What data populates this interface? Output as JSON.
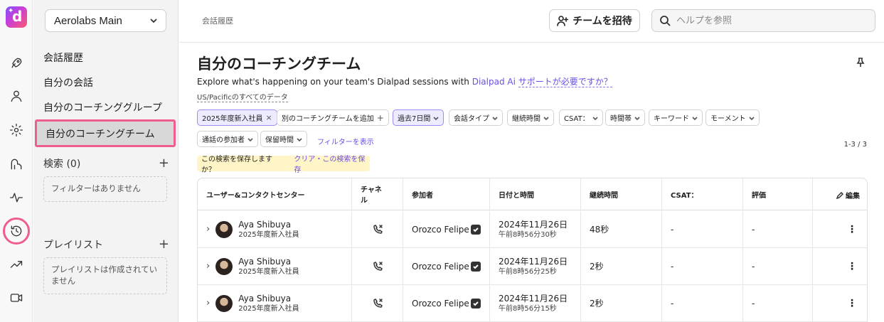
{
  "app": {
    "logo_letter": "d"
  },
  "rail": {
    "icons": [
      "rocket-icon",
      "person-icon",
      "gear-icon",
      "coaching-icon",
      "pulse-icon",
      "history-icon",
      "trending-icon",
      "video-icon"
    ],
    "active_icon": "history-icon"
  },
  "panel": {
    "workspace": "Aerolabs Main",
    "nav": [
      "会話履歴",
      "自分の会話",
      "自分のコーチンググループ",
      "自分のコーチングチーム"
    ],
    "selected_nav": "自分のコーチングチーム",
    "search_section": {
      "title": "検索 (0)",
      "plus": "+",
      "empty_text": "フィルターはありません"
    },
    "playlist_section": {
      "title": "プレイリスト",
      "plus": "+",
      "empty_text": "プレイリストは作成されていません"
    }
  },
  "header": {
    "breadcrumb": "会話履歴",
    "invite_label": "チームを招待",
    "help_placeholder": "ヘルプを参照"
  },
  "main": {
    "title": "自分のコーチングチーム",
    "subtitle_text": "Explore what's happening on your team's Dialpad sessions with",
    "subtitle_link": "Dialpad Ai",
    "help_link": "サポートが必要ですか？",
    "timezone": "US/Pacificのすべてのデータ",
    "filters_row1": [
      {
        "label": "2025年度新入社員",
        "suffix": "×",
        "active": true
      },
      {
        "label": "別のコーチングチームを追加",
        "suffix": "+",
        "active": false
      },
      {
        "label": "過去7日間",
        "suffix": "chevron",
        "active": true
      },
      {
        "label": "会話タイプ",
        "suffix": "chevron",
        "active": false
      },
      {
        "label": "継続時間",
        "suffix": "chevron",
        "active": false
      },
      {
        "label": "CSAT：",
        "suffix": "chevron",
        "active": false
      },
      {
        "label": "時間帯",
        "suffix": "chevron",
        "active": false
      },
      {
        "label": "キーワード",
        "suffix": "chevron",
        "active": false
      },
      {
        "label": "モーメント",
        "suffix": "chevron",
        "active": false
      }
    ],
    "filters_row2": [
      {
        "label": "通話の参加者",
        "suffix": "chevron",
        "active": false
      },
      {
        "label": "保留時間",
        "suffix": "chevron",
        "active": false
      }
    ],
    "show_filters": "フィルターを表示",
    "count": "1-3 / 3",
    "save_prompt": "この検索を保存しますか？",
    "save_actions": "クリア・この検索を保存"
  },
  "table": {
    "columns": [
      "ユーザー&コンタクトセンター",
      "チャネル",
      "参加者",
      "日付と時間",
      "継続時間",
      "CSAT：",
      "評価"
    ],
    "edit_label": "編集",
    "rows": [
      {
        "name": "Aya Shibuya",
        "group": "2025年度新入社員",
        "channel": "phone-missed-icon",
        "participant": "Orozco Felipe",
        "date": "2024年11月26日",
        "time": "午前8時56分30秒",
        "duration": "48秒",
        "csat": "-",
        "rating": "-"
      },
      {
        "name": "Aya Shibuya",
        "group": "2025年度新入社員",
        "channel": "phone-missed-icon",
        "participant": "Orozco Felipe",
        "date": "2024年11月26日",
        "time": "午前8時56分25秒",
        "duration": "2秒",
        "csat": "-",
        "rating": "-"
      },
      {
        "name": "Aya Shibuya",
        "group": "2025年度新入社員",
        "channel": "phone-missed-icon",
        "participant": "Orozco Felipe",
        "date": "2024年11月26日",
        "time": "午前8時56分15秒",
        "duration": "2秒",
        "csat": "-",
        "rating": "-"
      }
    ]
  },
  "colors": {
    "accent": "#6b4ee6",
    "highlight": "#ef5d8f",
    "save_bar": "#fff5c7"
  }
}
